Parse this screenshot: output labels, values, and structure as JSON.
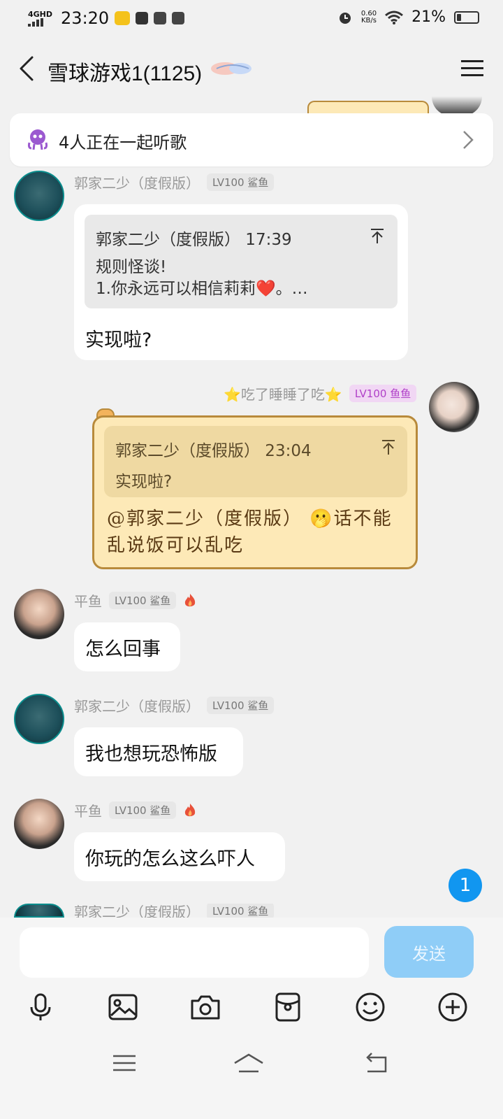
{
  "status": {
    "network": "4GHD",
    "time": "23:20",
    "speed_value": "0.60",
    "speed_unit": "KB/s",
    "battery": "21%",
    "battery_level": 0.21
  },
  "header": {
    "title": "雪球游戏1(1125)"
  },
  "listening": {
    "text": "4人正在一起听歌"
  },
  "messages": [
    {
      "sender": "郭家二少（度假版）",
      "level": "LV100",
      "title": "鲨鱼",
      "quote_header": "郭家二少（度假版） 17:39",
      "quote_line1": "规则怪谈!",
      "quote_line2": "1.你永远可以相信莉莉❤️。…",
      "text": "实现啦?"
    },
    {
      "sender": "⭐吃了睡睡了吃⭐",
      "level": "LV100",
      "title": "鱼鱼",
      "quote_header": "郭家二少（度假版） 23:04",
      "quote_body": "实现啦?",
      "text_line1": "@郭家二少（度假版） 🫢话不能",
      "text_line2": "乱说饭可以乱吃"
    },
    {
      "sender": "平鱼",
      "level": "LV100",
      "title": "鲨鱼",
      "text": "怎么回事"
    },
    {
      "sender": "郭家二少（度假版）",
      "level": "LV100",
      "title": "鲨鱼",
      "text": "我也想玩恐怖版"
    },
    {
      "sender": "平鱼",
      "level": "LV100",
      "title": "鲨鱼",
      "text": "你玩的怎么这么吓人"
    },
    {
      "sender": "郭家二少（度假版）",
      "level": "LV100",
      "title": "鲨鱼"
    }
  ],
  "unread_count": "1",
  "composer": {
    "placeholder": "",
    "send_label": "发送"
  },
  "toolbar_icons": [
    "microphone-icon",
    "image-icon",
    "camera-icon",
    "red-packet-icon",
    "emoji-icon",
    "plus-icon"
  ],
  "colors": {
    "accent": "#1196f0",
    "send_disabled": "#8fcdf7",
    "bubble_gold": "#fde9b7",
    "level_badge_bg": "#e7e7e7",
    "vip_badge": "#b040c8"
  }
}
